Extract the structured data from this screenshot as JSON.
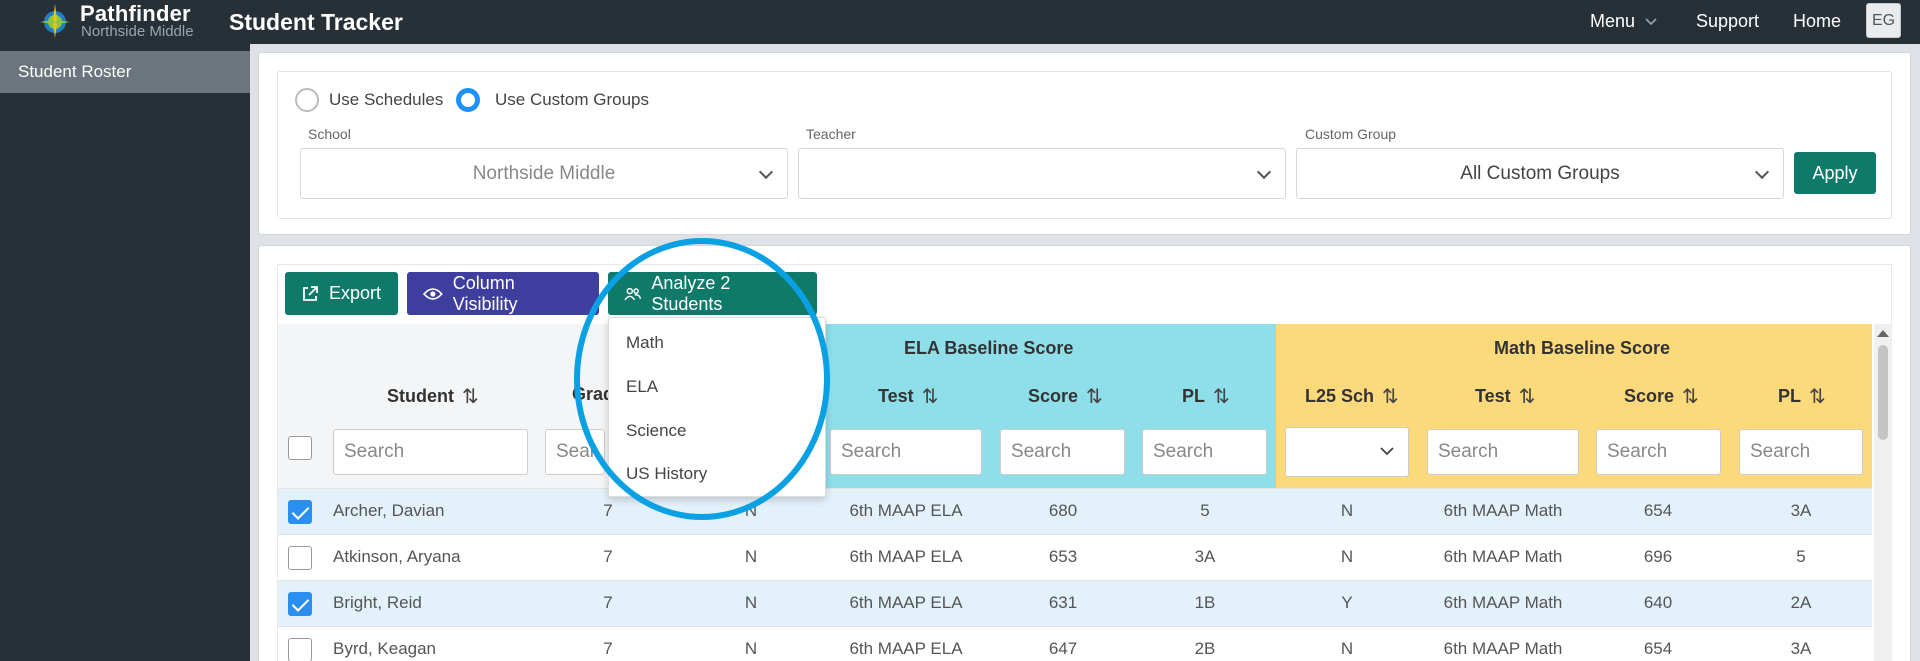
{
  "colors": {
    "topbar": "#283037",
    "accent_teal": "#0f7a6a",
    "accent_indigo": "#3e3e9e",
    "ela_header": "#8fdfeb",
    "math_header": "#fcd97b",
    "highlight_ring": "#0aa0e4",
    "selected_row": "#e3f1fb"
  },
  "header": {
    "brand_name": "Pathfinder",
    "brand_sub": "Northside Middle",
    "app_title": "Student Tracker",
    "nav": {
      "menu": "Menu",
      "support": "Support",
      "home": "Home"
    },
    "avatar": "EG",
    "icons": {
      "logo": "compass-logo-icon",
      "menu_caret": "chevron-down-icon"
    }
  },
  "sidebar": {
    "items": [
      {
        "label": "Student Roster",
        "active": true
      }
    ]
  },
  "filters": {
    "radio_schedules": "Use Schedules",
    "radio_custom": "Use Custom Groups",
    "selected_mode": "custom_groups",
    "school_label": "School",
    "school_value": "Northside Middle",
    "teacher_label": "Teacher",
    "teacher_value": "",
    "group_label": "Custom Group",
    "group_value": "All Custom Groups",
    "apply": "Apply"
  },
  "toolbar": {
    "export": "Export",
    "column_visibility": "Column Visibility",
    "analyze": "Analyze 2 Students",
    "icons": {
      "export": "external-link-icon",
      "column_visibility": "eye-icon",
      "analyze": "users-icon"
    }
  },
  "analyze_menu": {
    "items": [
      "Math",
      "ELA",
      "Science",
      "US History"
    ]
  },
  "table": {
    "groups": {
      "ela": "ELA Baseline Score",
      "math": "Math Baseline Score"
    },
    "columns": {
      "student": "Student",
      "grade": "Grad",
      "ela_test": "Test",
      "ela_score": "Score",
      "ela_pl": "PL",
      "math_l25": "L25 Sch",
      "math_test": "Test",
      "math_score": "Score",
      "math_pl": "PL"
    },
    "sort_glyph": "⇅",
    "search_placeholder": "Search",
    "grade_search_partial": "Sear",
    "rows": [
      {
        "checked": true,
        "student": "Archer, Davian",
        "grade": "7",
        "l25_ela": "N",
        "ela_test": "6th MAAP ELA",
        "ela_score": "680",
        "ela_pl": "5",
        "l25_math": "N",
        "math_test": "6th MAAP Math",
        "math_score": "654",
        "math_pl": "3A"
      },
      {
        "checked": false,
        "student": "Atkinson, Aryana",
        "grade": "7",
        "l25_ela": "N",
        "ela_test": "6th MAAP ELA",
        "ela_score": "653",
        "ela_pl": "3A",
        "l25_math": "N",
        "math_test": "6th MAAP Math",
        "math_score": "696",
        "math_pl": "5"
      },
      {
        "checked": true,
        "student": "Bright, Reid",
        "grade": "7",
        "l25_ela": "N",
        "ela_test": "6th MAAP ELA",
        "ela_score": "631",
        "ela_pl": "1B",
        "l25_math": "Y",
        "math_test": "6th MAAP Math",
        "math_score": "640",
        "math_pl": "2A"
      },
      {
        "checked": false,
        "student": "Byrd, Keagan",
        "grade": "7",
        "l25_ela": "N",
        "ela_test": "6th MAAP ELA",
        "ela_score": "647",
        "ela_pl": "2B",
        "l25_math": "N",
        "math_test": "6th MAAP Math",
        "math_score": "654",
        "math_pl": "3A"
      }
    ]
  }
}
